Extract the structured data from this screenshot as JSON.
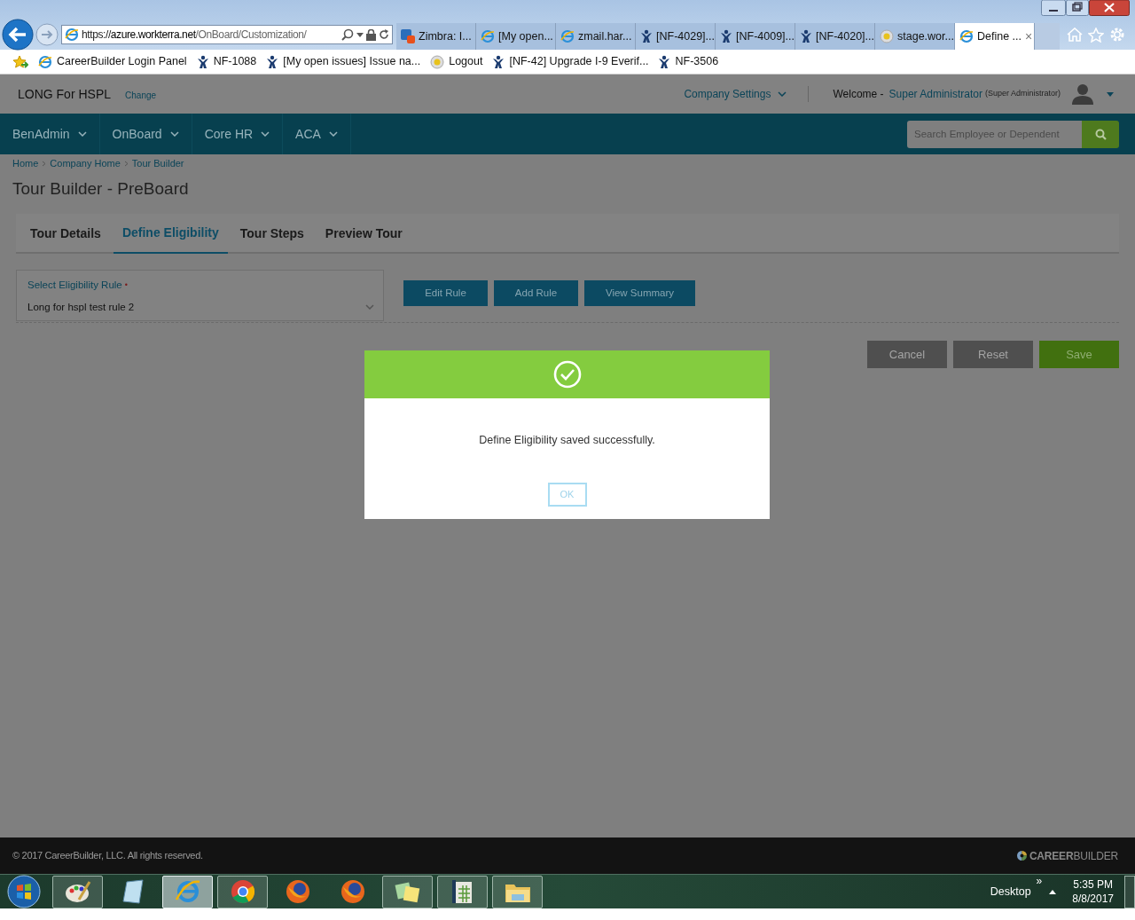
{
  "browser": {
    "url_prefix": "https://",
    "url_host": "azure.workterra.net",
    "url_path": "/OnBoard/Customization/",
    "tabs": [
      {
        "label": "Zimbra: I...",
        "kind": "zimbra",
        "selected": false
      },
      {
        "label": "[My open...",
        "kind": "ie",
        "selected": false
      },
      {
        "label": "zmail.har...",
        "kind": "ie",
        "selected": false
      },
      {
        "label": "[NF-4029]...",
        "kind": "jira",
        "selected": false
      },
      {
        "label": "[NF-4009]...",
        "kind": "jira",
        "selected": false
      },
      {
        "label": "[NF-4020]...",
        "kind": "jira",
        "selected": false
      },
      {
        "label": "stage.wor...",
        "kind": "stage",
        "selected": false
      },
      {
        "label": "Define ...",
        "kind": "ie",
        "selected": true
      }
    ],
    "close_tab": "×",
    "favorites": [
      {
        "label": "CareerBuilder Login Panel",
        "kind": "ie"
      },
      {
        "label": "NF-1088",
        "kind": "jira"
      },
      {
        "label": "[My open issues] Issue na...",
        "kind": "jira"
      },
      {
        "label": "Logout",
        "kind": "stage"
      },
      {
        "label": "[NF-42] Upgrade I-9 Everif...",
        "kind": "jira"
      },
      {
        "label": "NF-3506",
        "kind": "jira"
      }
    ]
  },
  "header": {
    "company": "LONG For HSPL",
    "change": "Change",
    "settings": "Company Settings",
    "welcome": "Welcome -",
    "user": "Super Administrator",
    "role": "(Super Administrator)"
  },
  "nav": {
    "menus": [
      "BenAdmin",
      "OnBoard",
      "Core HR",
      "ACA"
    ],
    "search": {
      "placeholder": "Search Employee or Dependent"
    }
  },
  "breadcrumb": [
    "Home",
    "Company Home",
    "Tour Builder"
  ],
  "title": "Tour Builder - PreBoard",
  "tabs": [
    {
      "label": "Tour Details",
      "selected": false
    },
    {
      "label": "Define Eligibility",
      "selected": true
    },
    {
      "label": "Tour Steps",
      "selected": false
    },
    {
      "label": "Preview Tour",
      "selected": false
    }
  ],
  "rule": {
    "label": "Select Eligibility Rule",
    "required_mark": "•",
    "value": "Long for hspl test rule 2"
  },
  "rule_buttons": [
    "Edit Rule",
    "Add Rule",
    "View Summary"
  ],
  "actions": [
    {
      "label": "Cancel",
      "kind": "neutral"
    },
    {
      "label": "Reset",
      "kind": "neutral"
    },
    {
      "label": "Save",
      "kind": "primary"
    }
  ],
  "dialog": {
    "message": "Define Eligibility saved successfully.",
    "button": "OK"
  },
  "footer": {
    "copyright": "© 2017 CareerBuilder, LLC. All rights reserved.",
    "brand_bold": "CAREER",
    "brand_light": "BUILDER"
  },
  "taskbar": {
    "apps": [
      {
        "kind": "paint",
        "running": true,
        "selected": false
      },
      {
        "kind": "notepad",
        "running": false,
        "selected": false
      },
      {
        "kind": "ie",
        "running": true,
        "selected": true
      },
      {
        "kind": "chrome",
        "running": true,
        "selected": false
      },
      {
        "kind": "firefox",
        "running": false,
        "selected": false
      },
      {
        "kind": "firefox",
        "running": false,
        "selected": false
      },
      {
        "kind": "notes",
        "running": true,
        "selected": false
      },
      {
        "kind": "calc",
        "running": true,
        "selected": false
      },
      {
        "kind": "folder",
        "running": true,
        "selected": false
      }
    ],
    "desktop": "Desktop",
    "chevron": "»",
    "time": "5:35 PM",
    "date": "8/8/2017"
  }
}
